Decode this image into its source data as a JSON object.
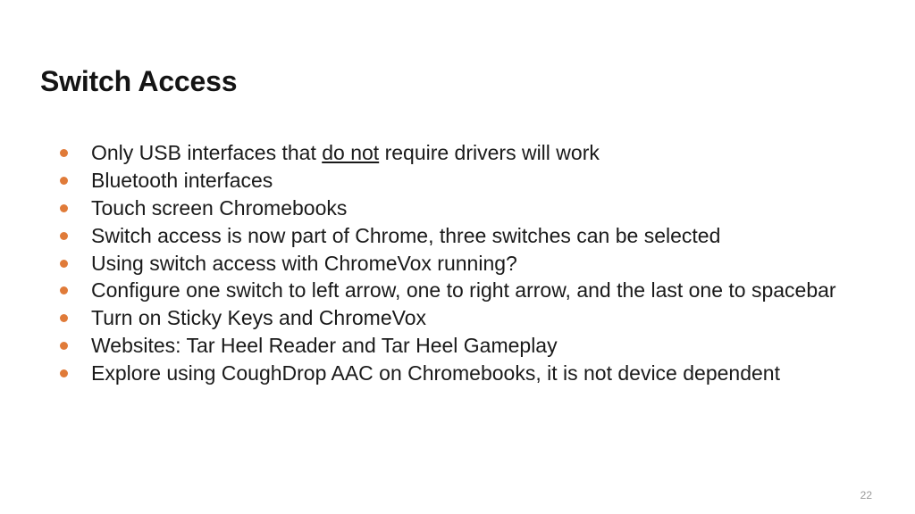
{
  "slide": {
    "title": "Switch Access",
    "page_number": "22",
    "accent_color": "#E07B39",
    "text_color": "#1a1a1a",
    "background_color": "#ffffff",
    "bullets": [
      {
        "segments": [
          {
            "text": "Only USB interfaces that ",
            "underline": false
          },
          {
            "text": "do not",
            "underline": true
          },
          {
            "text": " require drivers will work",
            "underline": false
          }
        ],
        "plain": "Only USB interfaces that do not require drivers will work"
      },
      {
        "segments": [
          {
            "text": "Bluetooth interfaces",
            "underline": false
          }
        ],
        "plain": "Bluetooth interfaces"
      },
      {
        "segments": [
          {
            "text": "Touch screen Chromebooks",
            "underline": false
          }
        ],
        "plain": "Touch screen Chromebooks"
      },
      {
        "segments": [
          {
            "text": "Switch access is now part of Chrome, three switches can be selected",
            "underline": false
          }
        ],
        "plain": "Switch access is now part of Chrome, three switches can be selected"
      },
      {
        "segments": [
          {
            "text": "Using switch access with ChromeVox running?",
            "underline": false
          }
        ],
        "plain": "Using switch access with ChromeVox running?"
      },
      {
        "segments": [
          {
            "text": "Configure one switch to left arrow, one to right arrow, and the last one to spacebar",
            "underline": false
          }
        ],
        "plain": "Configure one switch to left arrow, one to right arrow, and the last one to spacebar"
      },
      {
        "segments": [
          {
            "text": "Turn on Sticky Keys and ChromeVox",
            "underline": false
          }
        ],
        "plain": "Turn on Sticky Keys and ChromeVox"
      },
      {
        "segments": [
          {
            "text": "Websites: Tar Heel Reader and Tar Heel Gameplay",
            "underline": false
          }
        ],
        "plain": "Websites: Tar Heel Reader and Tar Heel Gameplay"
      },
      {
        "segments": [
          {
            "text": "Explore using CoughDrop AAC on Chromebooks, it is not device dependent",
            "underline": false
          }
        ],
        "plain": "Explore using CoughDrop AAC on Chromebooks, it is not device dependent"
      }
    ]
  }
}
